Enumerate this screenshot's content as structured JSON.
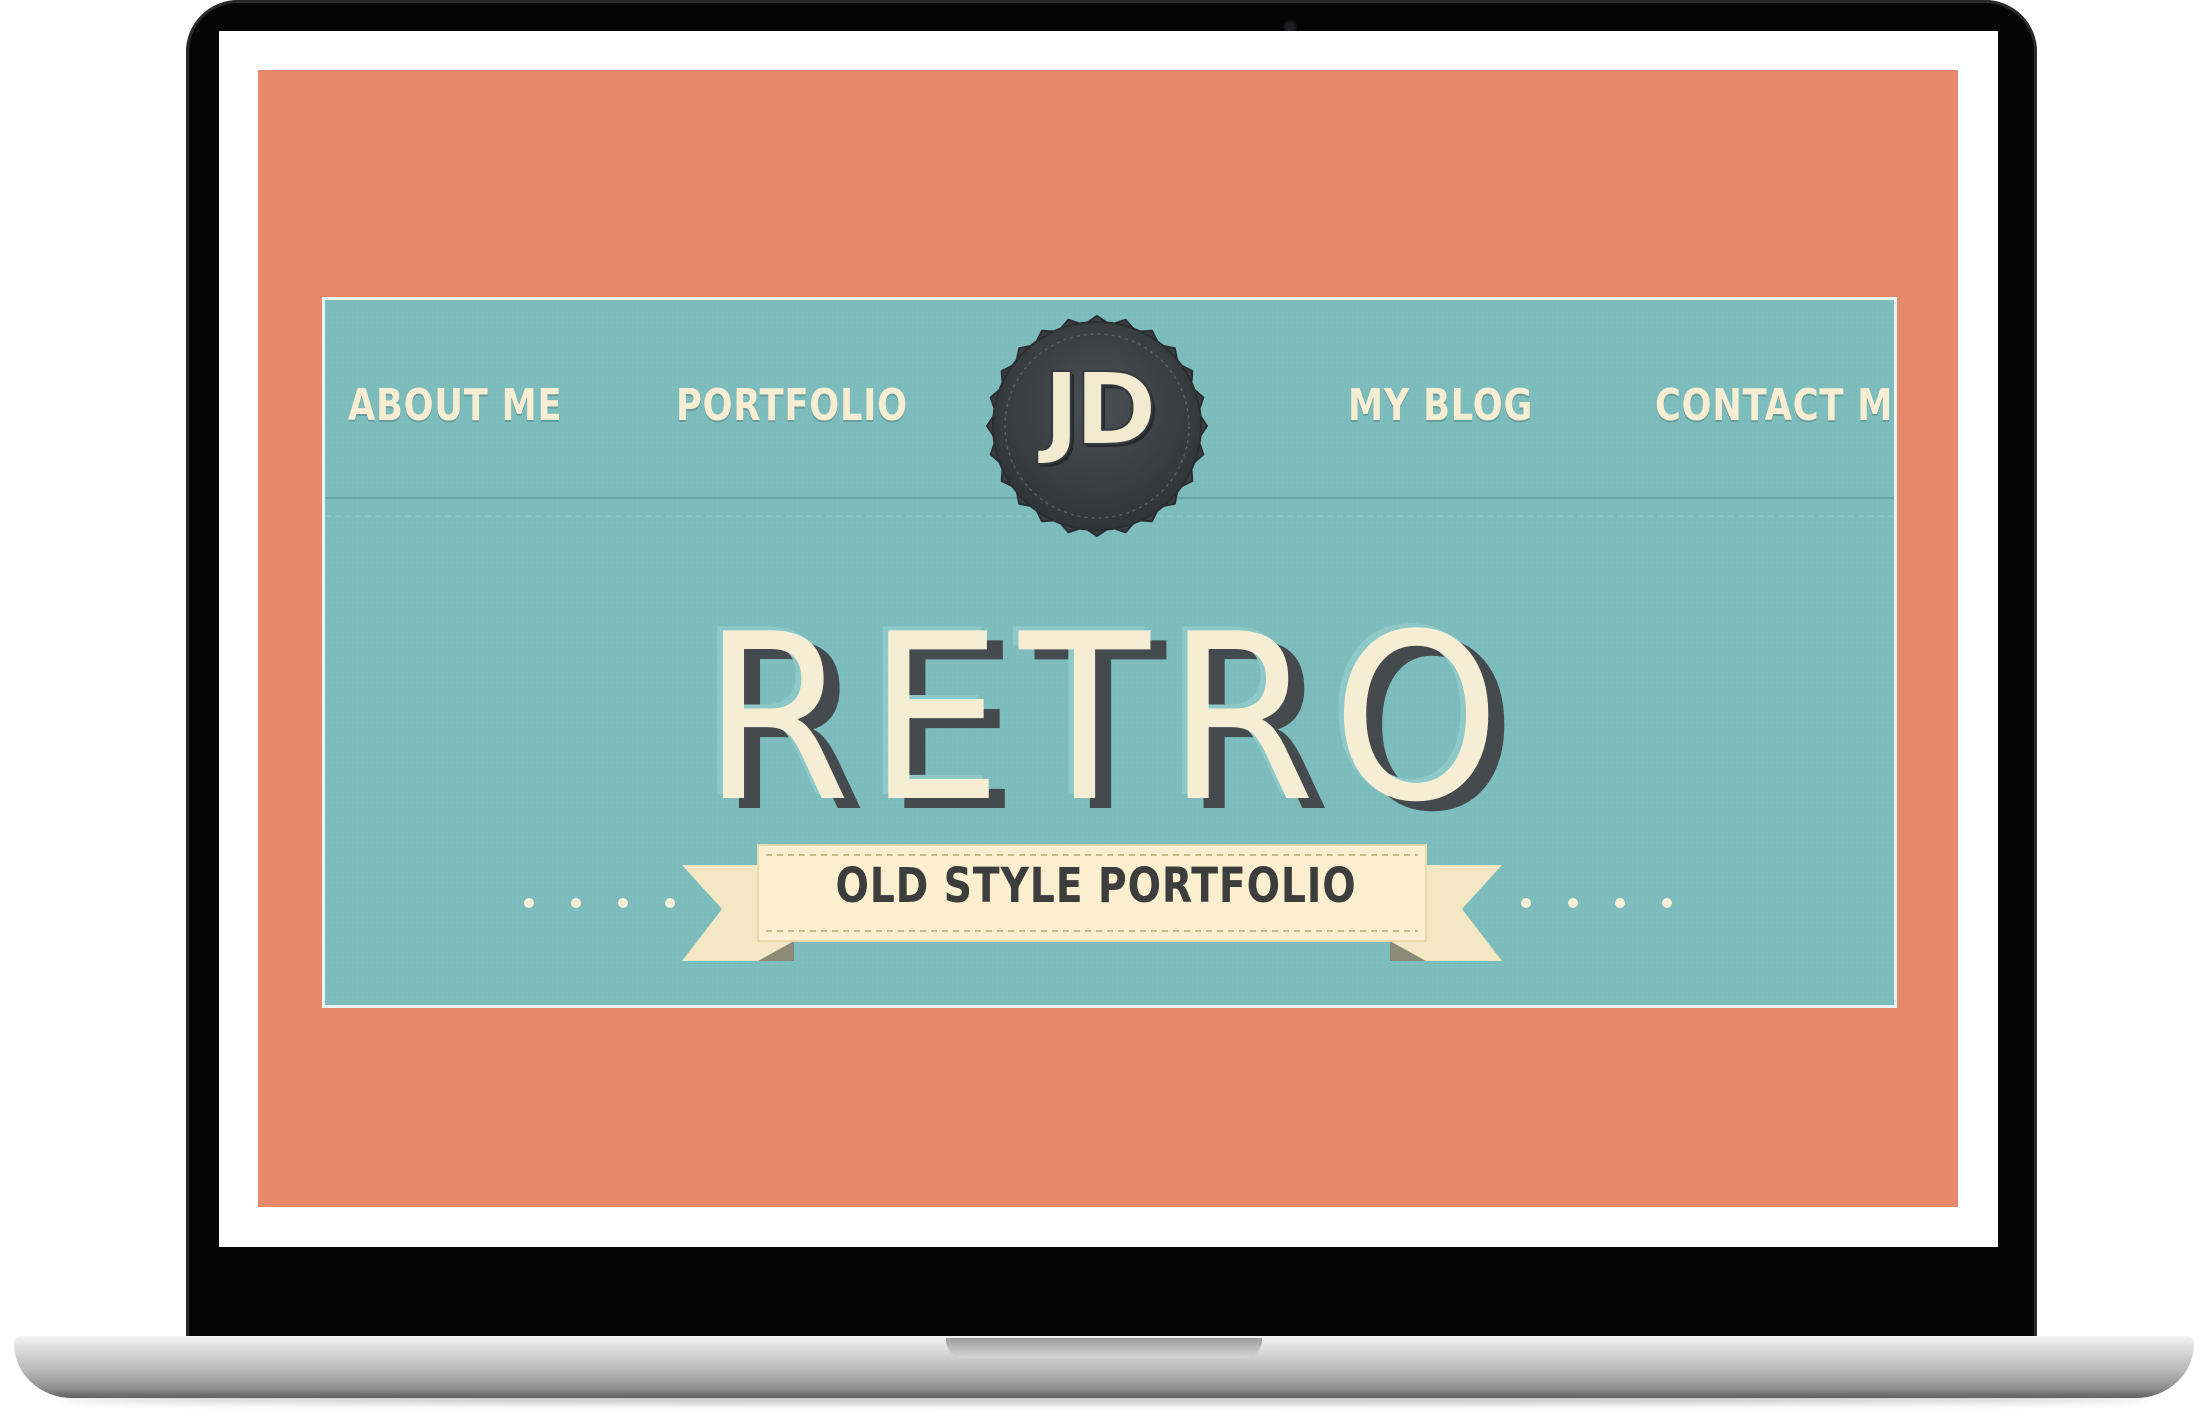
{
  "nav": {
    "left": [
      "ABOUT ME",
      "PORTFOLIO"
    ],
    "right": [
      "MY BLOG",
      "CONTACT ME"
    ]
  },
  "logo": {
    "initials": "JD"
  },
  "hero": {
    "title": "RETRO",
    "ribbon": "OLD STYLE PORTFOLIO"
  },
  "colors": {
    "page_background": "#e6886a",
    "hero_background": "#7cbcbc",
    "cream": "#f6eed4",
    "badge": "#3b3f43",
    "dark_text": "#3c3d3d"
  },
  "icons": [
    "jd-logo-badge",
    "ribbon-banner",
    "decorative-dots"
  ]
}
